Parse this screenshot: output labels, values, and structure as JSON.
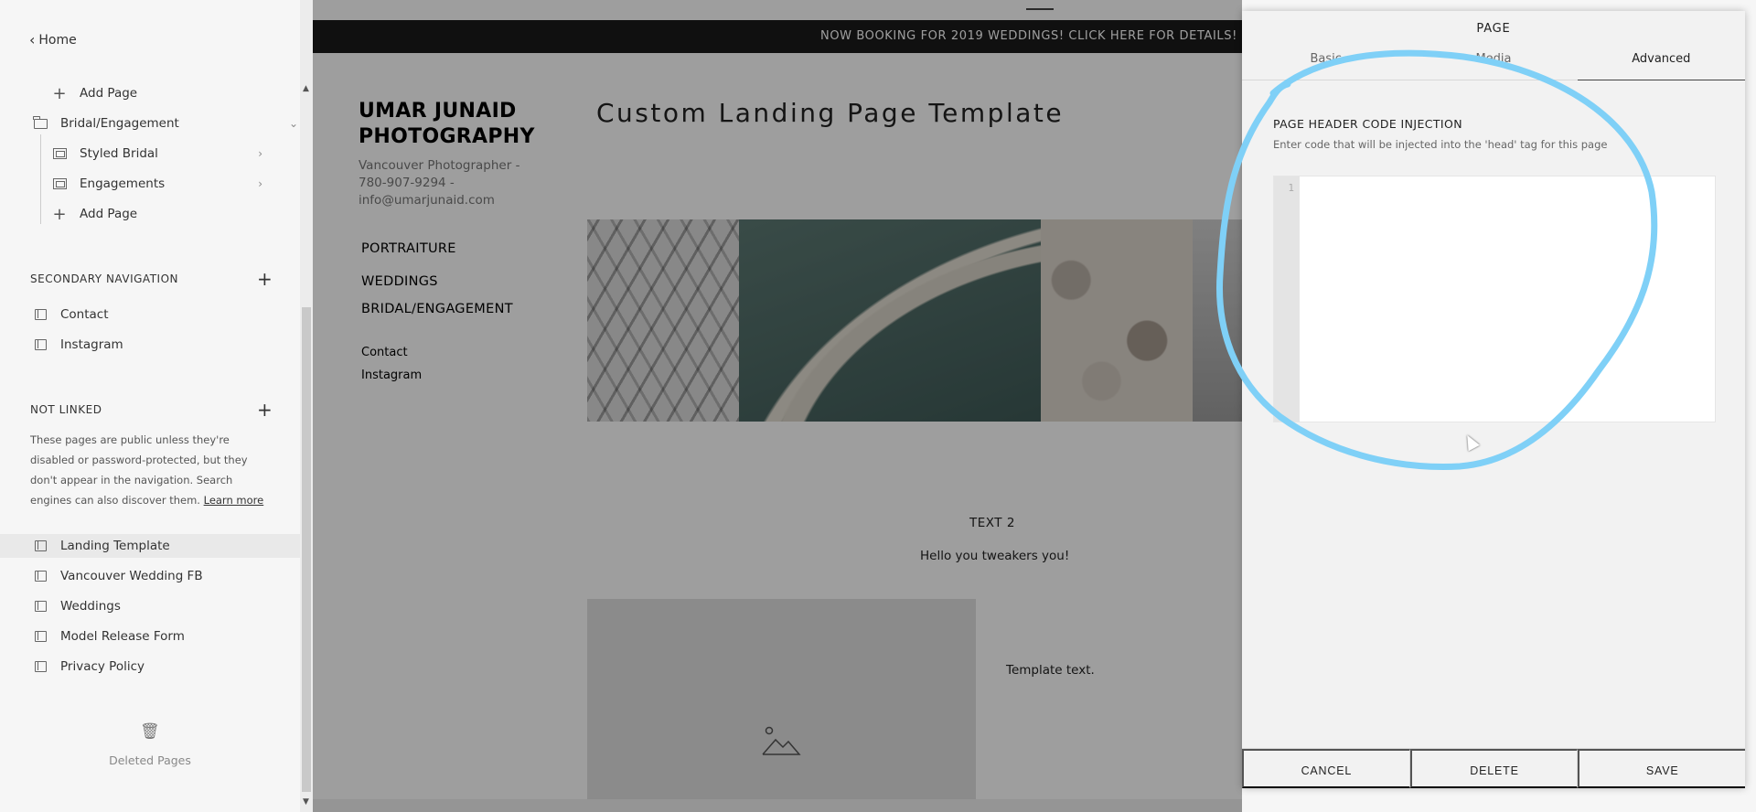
{
  "sidebar": {
    "home_label": "Home",
    "rows_top": [
      {
        "label": "Add Page",
        "icon": "plus-icon"
      },
      {
        "label": "Bridal/Engagement",
        "icon": "folder-icon"
      },
      {
        "label": "Styled Bridal",
        "icon": "gallery-icon"
      },
      {
        "label": "Engagements",
        "icon": "gallery-icon"
      },
      {
        "label": "Add Page",
        "icon": "plus-icon"
      }
    ],
    "secondary_nav": {
      "title": "SECONDARY NAVIGATION",
      "items": [
        "Contact",
        "Instagram"
      ]
    },
    "not_linked": {
      "title": "NOT LINKED",
      "description": "These pages are public unless they're disabled or password-protected, but they don't appear in the navigation. Search engines can also discover them.",
      "learn_more": "Learn more",
      "items": [
        "Landing Template",
        "Vancouver Wedding FB",
        "Weddings",
        "Model Release Form",
        "Privacy Policy"
      ]
    },
    "deleted_label": "Deleted Pages"
  },
  "preview": {
    "announcement": "NOW BOOKING FOR 2019 WEDDINGS! CLICK HERE FOR DETAILS!",
    "site_title_line1": "UMAR JUNAID",
    "site_title_line2": "PHOTOGRAPHY",
    "site_sub_line1": "Vancouver Photographer -",
    "site_sub_line2": "780-907-9294 -",
    "site_sub_line3": "info@umarjunaid.com",
    "nav": [
      "PORTRAITURE",
      "WEDDINGS",
      "BRIDAL/ENGAGEMENT"
    ],
    "secondary": [
      "Contact",
      "Instagram"
    ],
    "page_heading": "Custom Landing Page Template",
    "text2": "TEXT 2",
    "hello": "Hello you tweakers you!",
    "template_text": "Template text."
  },
  "panel": {
    "title": "PAGE",
    "tabs": [
      "Basic",
      "Media",
      "Advanced"
    ],
    "active_tab": "Advanced",
    "field_label": "PAGE HEADER CODE INJECTION",
    "field_desc": "Enter code that will be injected into the 'head' tag for this page",
    "line_number": "1",
    "code_value": "",
    "buttons": {
      "cancel": "CANCEL",
      "delete": "DELETE",
      "save": "SAVE"
    }
  },
  "colors": {
    "annotation": "#7fd0f7",
    "announcement_bg": "#1a1a1a",
    "panel_bg": "#f2f2f2"
  }
}
